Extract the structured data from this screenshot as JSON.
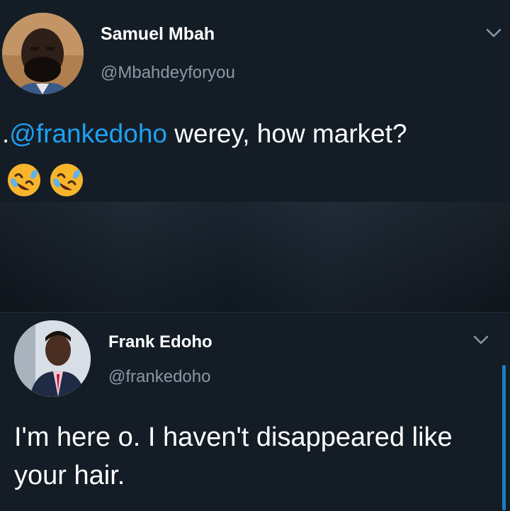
{
  "tweet1": {
    "name": "Samuel Mbah",
    "handle": "@Mbahdeyforyou",
    "text_prefix": ".",
    "mention": "@frankedoho",
    "text_rest": " werey, how market?",
    "emojis": [
      "rolling-on-floor-laughing-emoji",
      "rolling-on-floor-laughing-emoji"
    ],
    "chevron_icon": "chevron-down-icon"
  },
  "tweet2": {
    "name": "Frank Edoho",
    "handle": "@frankedoho",
    "text": "I'm here o.  I haven't disappeared like your hair.",
    "chevron_icon": "chevron-down-icon"
  },
  "colors": {
    "background": "#141d26",
    "mention": "#1da1f2",
    "handle": "#8899a6",
    "scrollbar": "#1d7fbf"
  }
}
